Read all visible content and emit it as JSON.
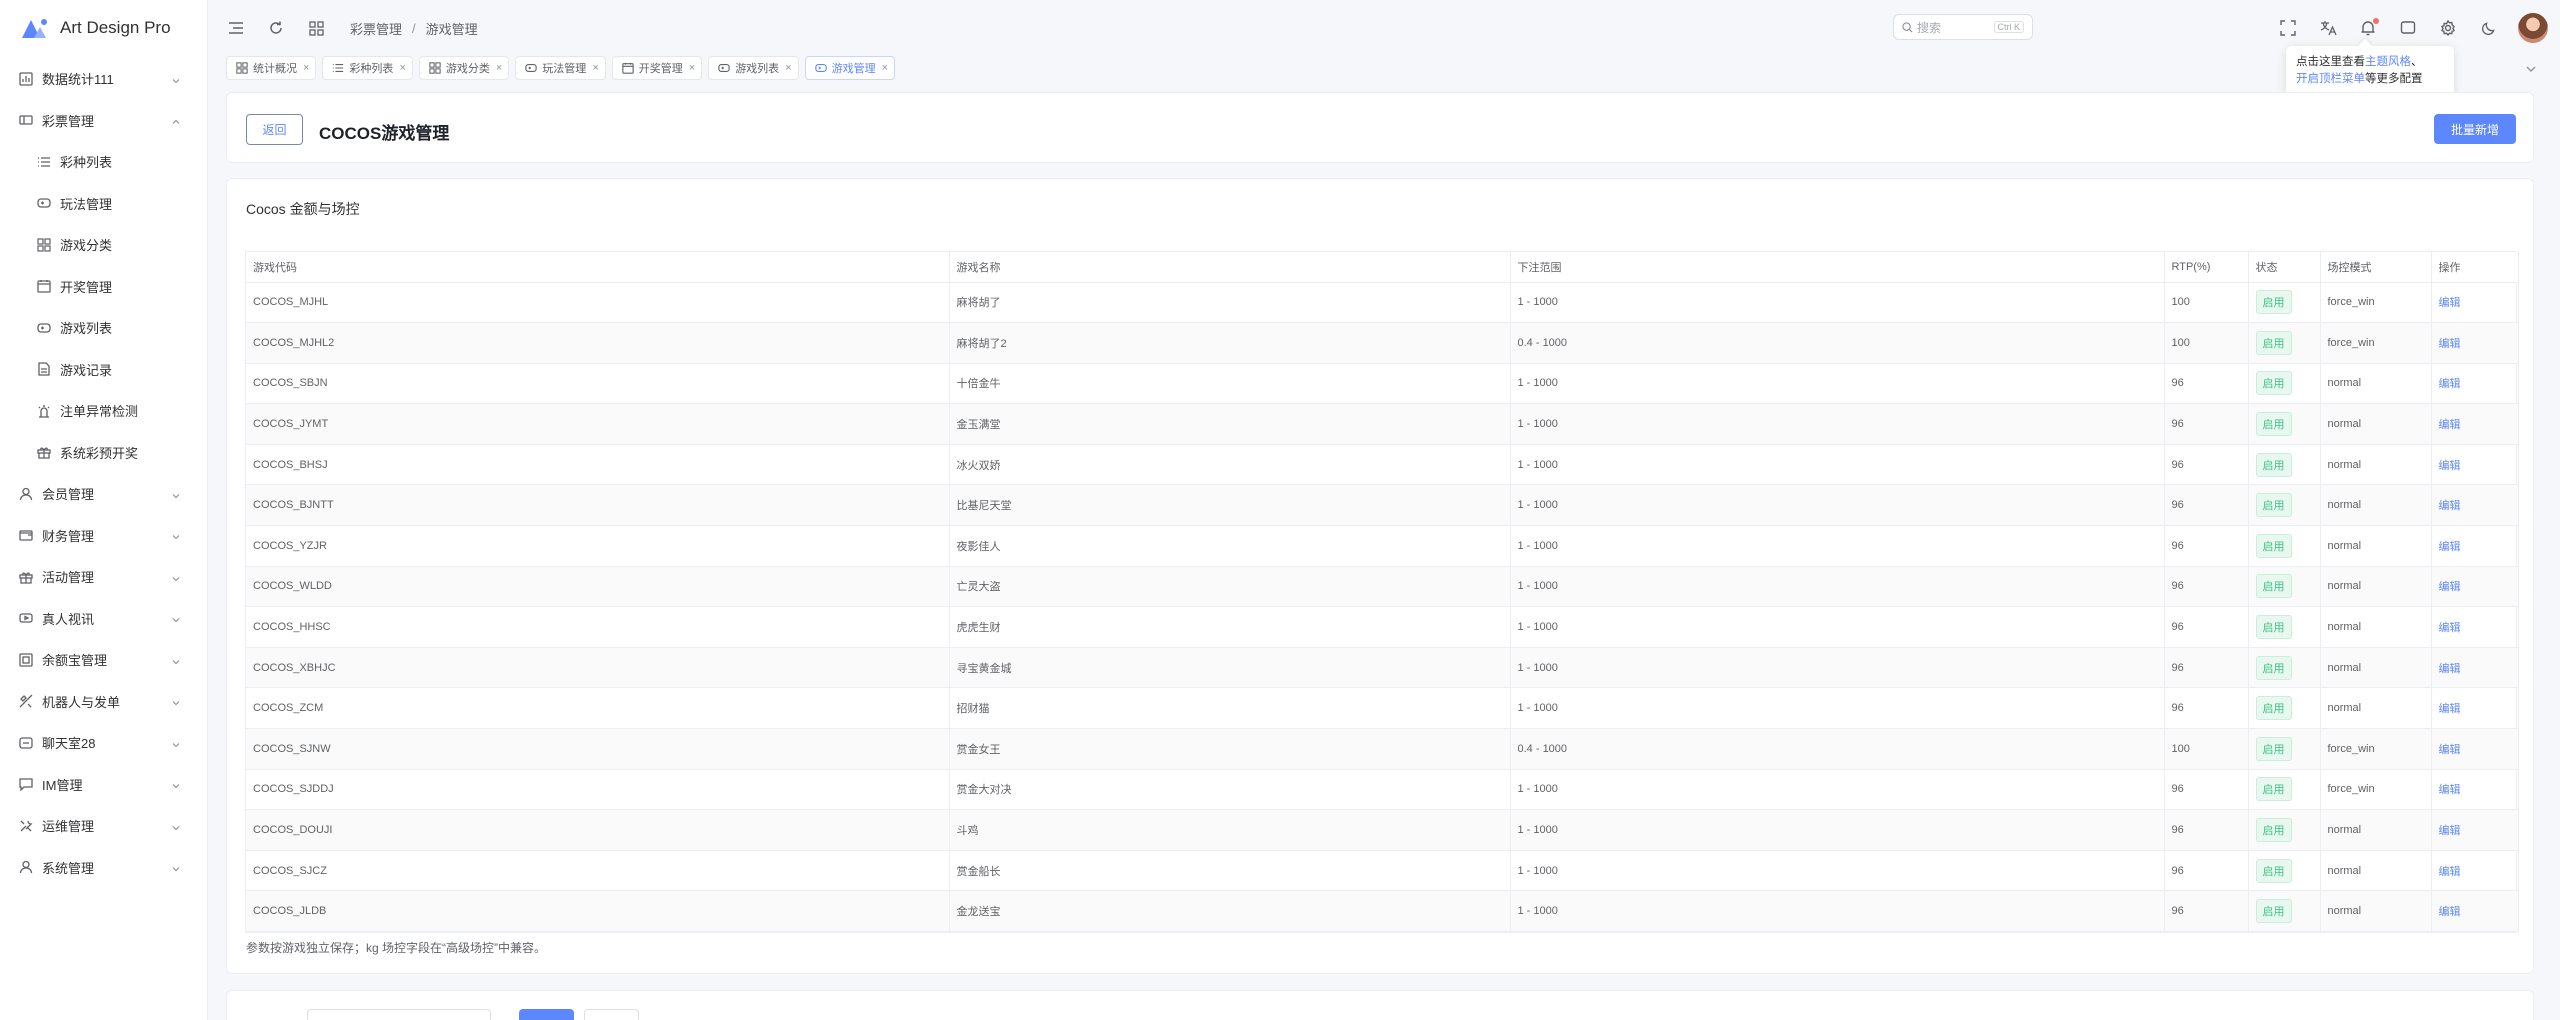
{
  "brand": {
    "name": "Art Design Pro",
    "accent": "#5d87ff"
  },
  "sidebar": {
    "items": [
      {
        "label": "数据统计111",
        "icon": "chart-icon",
        "expandable": true,
        "sub": false
      },
      {
        "label": "彩票管理",
        "icon": "ticket-icon",
        "expandable": true,
        "expanded": true,
        "sub": false
      },
      {
        "label": "彩种列表",
        "icon": "list-icon",
        "sub": true
      },
      {
        "label": "玩法管理",
        "icon": "gamepad-icon",
        "sub": true
      },
      {
        "label": "游戏分类",
        "icon": "grid-icon",
        "sub": true
      },
      {
        "label": "开奖管理",
        "icon": "calendar-icon",
        "sub": true
      },
      {
        "label": "游戏列表",
        "icon": "gamepad-icon",
        "sub": true
      },
      {
        "label": "游戏记录",
        "icon": "document-icon",
        "sub": true
      },
      {
        "label": "注单异常检测",
        "icon": "alert-icon",
        "sub": true
      },
      {
        "label": "系统彩预开奖",
        "icon": "gift-icon",
        "sub": true
      },
      {
        "label": "会员管理",
        "icon": "user-icon",
        "expandable": true,
        "sub": false
      },
      {
        "label": "财务管理",
        "icon": "wallet-icon",
        "expandable": true,
        "sub": false
      },
      {
        "label": "活动管理",
        "icon": "gift-icon",
        "expandable": true,
        "sub": false
      },
      {
        "label": "真人视讯",
        "icon": "video-icon",
        "expandable": true,
        "sub": false
      },
      {
        "label": "余额宝管理",
        "icon": "safe-icon",
        "expandable": true,
        "sub": false
      },
      {
        "label": "机器人与发单",
        "icon": "robot-icon",
        "expandable": true,
        "sub": false
      },
      {
        "label": "聊天室28",
        "icon": "chat-icon",
        "expandable": true,
        "sub": false
      },
      {
        "label": "IM管理",
        "icon": "message-icon",
        "expandable": true,
        "sub": false
      },
      {
        "label": "运维管理",
        "icon": "tools-icon",
        "expandable": true,
        "sub": false
      },
      {
        "label": "系统管理",
        "icon": "user-icon",
        "expandable": true,
        "sub": false
      }
    ]
  },
  "header": {
    "breadcrumb": [
      "彩票管理",
      "游戏管理"
    ],
    "search": {
      "placeholder": "搜索",
      "shortcut": "Ctrl K"
    }
  },
  "tabs": [
    {
      "label": "统计概况",
      "icon": "grid-icon",
      "active": false
    },
    {
      "label": "彩种列表",
      "icon": "list-icon",
      "active": false
    },
    {
      "label": "游戏分类",
      "icon": "grid-icon",
      "active": false
    },
    {
      "label": "玩法管理",
      "icon": "gamepad-icon",
      "active": false
    },
    {
      "label": "开奖管理",
      "icon": "calendar-icon",
      "active": false
    },
    {
      "label": "游戏列表",
      "icon": "gamepad-icon",
      "active": false
    },
    {
      "label": "游戏管理",
      "icon": "gamepad-icon",
      "active": true
    }
  ],
  "tooltip": {
    "line1_prefix": "点击这里查看",
    "line1_link": "主题风格",
    "line1_suffix": "、",
    "line2_link": "开启顶栏菜单",
    "line2_suffix": "等更多配置"
  },
  "page": {
    "back_label": "返回",
    "title": "COCOS游戏管理",
    "batch_label": "批量新增"
  },
  "section": {
    "title": "Cocos 金额与场控",
    "note": "参数按游戏独立保存；kg 场控字段在“高级场控”中兼容。"
  },
  "table": {
    "columns": [
      "游戏代码",
      "游戏名称",
      "下注范围",
      "RTP(%)",
      "状态",
      "场控模式",
      "操作"
    ],
    "rows": [
      {
        "code": "COCOS_MJHL",
        "name": "麻将胡了",
        "range": "1 - 1000",
        "rtp": "100",
        "status": "启用",
        "mode": "force_win",
        "action": "编辑"
      },
      {
        "code": "COCOS_MJHL2",
        "name": "麻将胡了2",
        "range": "0.4 - 1000",
        "rtp": "100",
        "status": "启用",
        "mode": "force_win",
        "action": "编辑"
      },
      {
        "code": "COCOS_SBJN",
        "name": "十倍金牛",
        "range": "1 - 1000",
        "rtp": "96",
        "status": "启用",
        "mode": "normal",
        "action": "编辑"
      },
      {
        "code": "COCOS_JYMT",
        "name": "金玉满堂",
        "range": "1 - 1000",
        "rtp": "96",
        "status": "启用",
        "mode": "normal",
        "action": "编辑"
      },
      {
        "code": "COCOS_BHSJ",
        "name": "冰火双娇",
        "range": "1 - 1000",
        "rtp": "96",
        "status": "启用",
        "mode": "normal",
        "action": "编辑"
      },
      {
        "code": "COCOS_BJNTT",
        "name": "比基尼天堂",
        "range": "1 - 1000",
        "rtp": "96",
        "status": "启用",
        "mode": "normal",
        "action": "编辑"
      },
      {
        "code": "COCOS_YZJR",
        "name": "夜影佳人",
        "range": "1 - 1000",
        "rtp": "96",
        "status": "启用",
        "mode": "normal",
        "action": "编辑"
      },
      {
        "code": "COCOS_WLDD",
        "name": "亡灵大盗",
        "range": "1 - 1000",
        "rtp": "96",
        "status": "启用",
        "mode": "normal",
        "action": "编辑"
      },
      {
        "code": "COCOS_HHSC",
        "name": "虎虎生财",
        "range": "1 - 1000",
        "rtp": "96",
        "status": "启用",
        "mode": "normal",
        "action": "编辑"
      },
      {
        "code": "COCOS_XBHJC",
        "name": "寻宝黄金城",
        "range": "1 - 1000",
        "rtp": "96",
        "status": "启用",
        "mode": "normal",
        "action": "编辑"
      },
      {
        "code": "COCOS_ZCM",
        "name": "招财猫",
        "range": "1 - 1000",
        "rtp": "96",
        "status": "启用",
        "mode": "normal",
        "action": "编辑"
      },
      {
        "code": "COCOS_SJNW",
        "name": "赏金女王",
        "range": "0.4 - 1000",
        "rtp": "100",
        "status": "启用",
        "mode": "force_win",
        "action": "编辑"
      },
      {
        "code": "COCOS_SJDDJ",
        "name": "赏金大对决",
        "range": "1 - 1000",
        "rtp": "96",
        "status": "启用",
        "mode": "force_win",
        "action": "编辑"
      },
      {
        "code": "COCOS_DOUJI",
        "name": "斗鸡",
        "range": "1 - 1000",
        "rtp": "96",
        "status": "启用",
        "mode": "normal",
        "action": "编辑"
      },
      {
        "code": "COCOS_SJCZ",
        "name": "赏金船长",
        "range": "1 - 1000",
        "rtp": "96",
        "status": "启用",
        "mode": "normal",
        "action": "编辑"
      },
      {
        "code": "COCOS_JLDB",
        "name": "金龙送宝",
        "range": "1 - 1000",
        "rtp": "96",
        "status": "启用",
        "mode": "normal",
        "action": "编辑"
      }
    ]
  }
}
